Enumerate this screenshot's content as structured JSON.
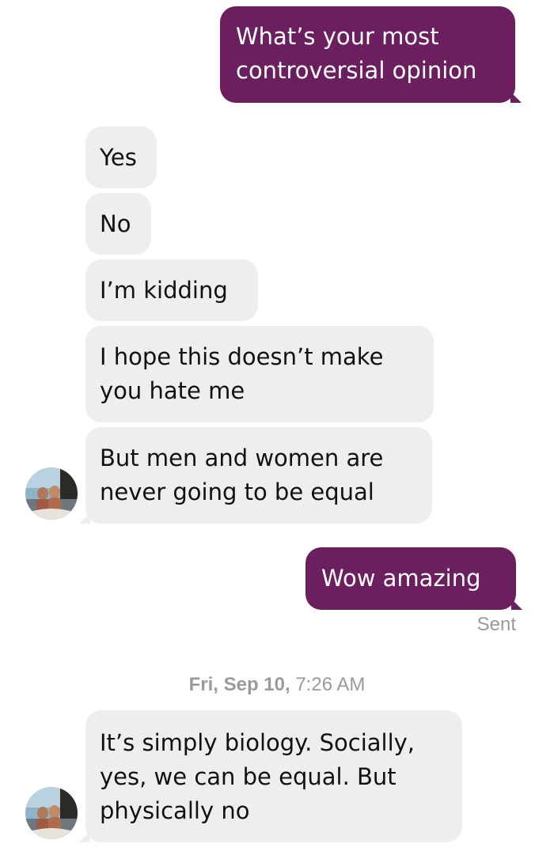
{
  "messages": {
    "m1": "What’s your most\ncontroversial opinion",
    "m2": "Yes",
    "m3": "No",
    "m4": "I’m kidding",
    "m5": "I hope this doesn’t make\nyou hate me",
    "m6": "But men and women are\nnever going to be equal",
    "m7": "Wow amazing",
    "m8": "It’s simply biology. Socially,\nyes, we can be equal. But\nphysically no"
  },
  "status": {
    "sent": "Sent"
  },
  "timestamp": {
    "day": "Fri, Sep 10,",
    "time": "7:26 AM"
  },
  "colors": {
    "outgoing_bubble": "#6b1f5e",
    "incoming_bubble": "#eeeef0"
  },
  "icons": {
    "avatar": "contact-avatar-photo"
  }
}
